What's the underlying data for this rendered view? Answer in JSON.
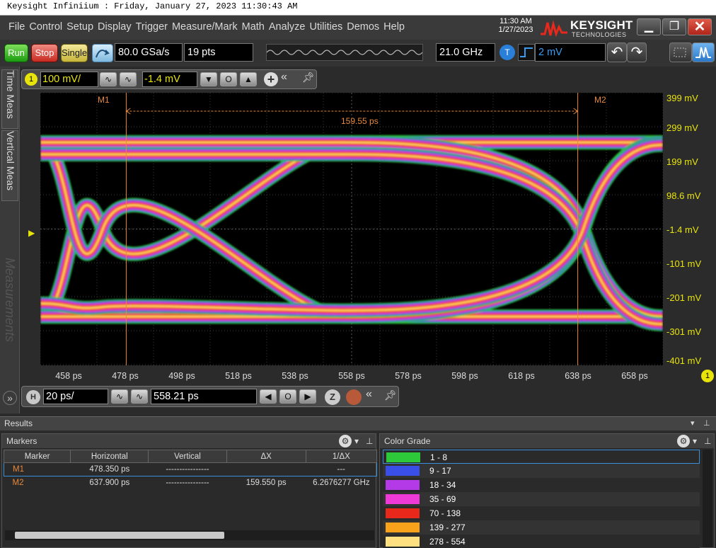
{
  "window": {
    "title": "Keysight Infiniium : Friday, January 27, 2023 11:30:43 AM"
  },
  "menu": [
    "File",
    "Control",
    "Setup",
    "Display",
    "Trigger",
    "Measure/Mark",
    "Math",
    "Analyze",
    "Utilities",
    "Demos",
    "Help"
  ],
  "clock": {
    "time": "11:30 AM",
    "date": "1/27/2023"
  },
  "brand": {
    "name": "KEYSIGHT",
    "sub": "TECHNOLOGIES"
  },
  "toolbar": {
    "run": "Run",
    "stop": "Stop",
    "single": "Single",
    "sample_rate": "80.0 GSa/s",
    "points": "19 pts",
    "bandwidth": "21.0 GHz",
    "trigger_badge": "T",
    "trigger_level": "2 mV"
  },
  "channel": {
    "badge": "1",
    "scale": "100 mV/",
    "offset": "-1.4 mV"
  },
  "side_tabs": [
    "Time Meas",
    "Vertical Meas",
    "Measurements"
  ],
  "horizontal": {
    "badge": "H",
    "scale": "20 ps/",
    "position": "558.21 ps"
  },
  "chart_data": {
    "type": "eye diagram",
    "y_ticks": [
      "399 mV",
      "299 mV",
      "199 mV",
      "98.6 mV",
      "-1.4 mV",
      "-101 mV",
      "-201 mV",
      "-301 mV",
      "-401 mV"
    ],
    "x_ticks": [
      "458 ps",
      "478 ps",
      "498 ps",
      "518 ps",
      "538 ps",
      "558 ps",
      "578 ps",
      "598 ps",
      "618 ps",
      "638 ps",
      "658 ps"
    ],
    "markers": [
      {
        "name": "M1",
        "x_ps": 478.35
      },
      {
        "name": "M2",
        "x_ps": 637.9
      }
    ],
    "delta_label": "159.55 ps",
    "ylim": [
      -451,
      449
    ],
    "xlim": [
      448,
      668
    ],
    "grid": true,
    "channel_badge": "1"
  },
  "results": {
    "title": "Results",
    "markers_panel": {
      "title": "Markers",
      "columns": [
        "Marker",
        "Horizontal",
        "Vertical",
        "ΔX",
        "1/ΔX"
      ],
      "rows": [
        {
          "marker": "M1",
          "horizontal": "478.350 ps",
          "vertical": "----------------",
          "dx": "",
          "inv_dx": "---"
        },
        {
          "marker": "M2",
          "horizontal": "637.900 ps",
          "vertical": "----------------",
          "dx": "159.550 ps",
          "inv_dx": "6.2676277 GHz"
        }
      ]
    },
    "color_grade": {
      "title": "Color Grade",
      "rows": [
        {
          "range": "1 - 8",
          "color": "#2ec93a"
        },
        {
          "range": "9 - 17",
          "color": "#3a4fe8"
        },
        {
          "range": "18 - 34",
          "color": "#b43ae8"
        },
        {
          "range": "35 - 69",
          "color": "#f03ad8"
        },
        {
          "range": "70 - 138",
          "color": "#e8281a"
        },
        {
          "range": "139 - 277",
          "color": "#f7a21a"
        },
        {
          "range": "278 - 554",
          "color": "#ffe080"
        }
      ]
    }
  }
}
